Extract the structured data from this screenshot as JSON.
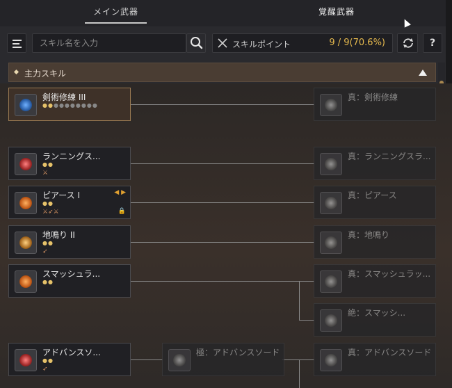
{
  "tabs": {
    "main": "メイン武器",
    "awakening": "覚醒武器"
  },
  "toolbar": {
    "search_placeholder": "スキル名を入力",
    "points_label": "スキルポイント",
    "points_value": "9 / 9(70.6%)",
    "help_label": "?"
  },
  "section": {
    "title": "主力スキル"
  },
  "skills": [
    {
      "name": "剣術修練 III",
      "pips": "●●●●●●●●",
      "true_name": "真：剣術修練"
    },
    {
      "name": "ランニングス...",
      "true_name": "真：ランニングスラ..."
    },
    {
      "name": "ピアース I",
      "true_name": "真：ピアース"
    },
    {
      "name": "地鳴り II",
      "true_name": "真：地鳴り"
    },
    {
      "name": "スマッシュラ...",
      "true_name": "真：スマッシュラッ...",
      "extra_name": "絶：スマッシ..."
    },
    {
      "name": "アドバンスソ...",
      "mid_name": "極：アドバンスソード",
      "true_name": "真：アドバンスソード"
    }
  ],
  "colors": {
    "accent": "#e5b94e",
    "section_bg": "#4a3d33",
    "selected_border": "#9a7a52"
  }
}
